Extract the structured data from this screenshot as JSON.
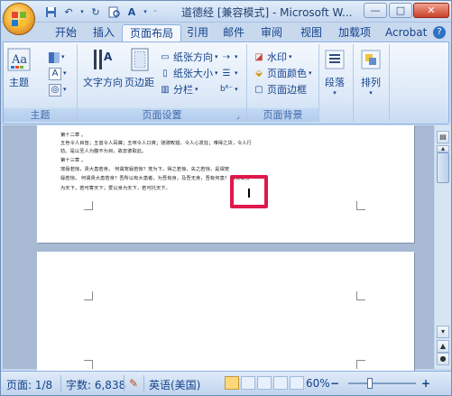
{
  "window": {
    "title": "道德经 [兼容模式] - Microsoft W...",
    "minimize_label": "—",
    "maximize_label": "□",
    "close_label": "✕"
  },
  "tabs": [
    "开始",
    "插入",
    "页面布局",
    "引用",
    "邮件",
    "审阅",
    "视图",
    "加载项",
    "Acrobat"
  ],
  "active_tab": "页面布局",
  "ribbon": {
    "groups": {
      "theme": {
        "label": "主题",
        "theme_button": "主题"
      },
      "page_setup": {
        "label": "页面设置",
        "text_direction": "文字方向",
        "margins": "页边距",
        "orientation": "纸张方向",
        "size": "纸张大小",
        "columns": "分栏",
        "breaks": "",
        "line_numbers": "",
        "hyphenation": "b⁶⁻"
      },
      "page_background": {
        "label": "页面背景",
        "watermark": "水印",
        "page_color": "页面颜色",
        "page_borders": "页面边框"
      },
      "paragraph": {
        "label": "段落"
      },
      "arrange": {
        "label": "排列"
      }
    }
  },
  "document": {
    "page1_lines": [
      "第十二章 。",
      "五色令人目盲；五音令人耳聋；五味令人口爽；驰骋畋猎，令人心发狂；难得之货，令人行",
      "妨。是以圣人为腹不为目，故去彼取此。",
      "第十三章 。",
      "宠辱若惊，贵大患若身。 何谓宠辱若惊？宠为下，得之若惊，失之若惊，是谓宠",
      "辱若惊。 何谓贵大患若身？吾所以有大患者，为吾有身，及吾无身，吾有何患？ 故贵以身",
      "为天下，若可寄天下；爱以身为天下，若可托天下。"
    ]
  },
  "statusbar": {
    "page": "页面: 1/8",
    "word_count": "字数: 6,838",
    "language": "英语(美国)",
    "zoom": "60%",
    "zoom_minus": "−",
    "zoom_plus": "+",
    "zoom_level": 0.3
  },
  "colors": {
    "accent": "#e0174b",
    "ribbon_text": "#15428b"
  }
}
